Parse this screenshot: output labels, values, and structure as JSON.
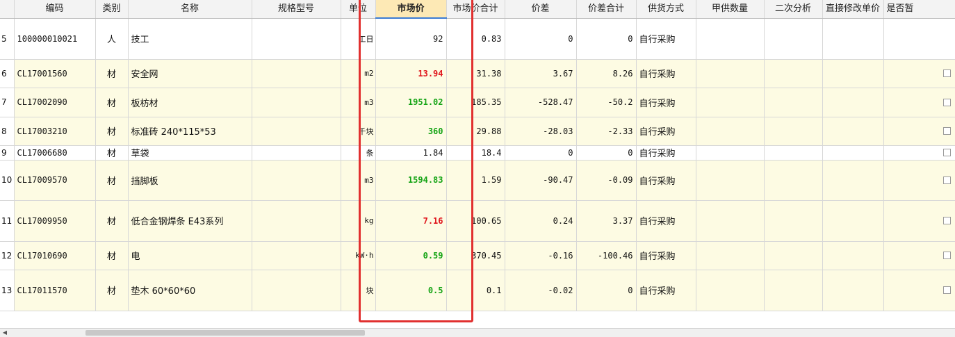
{
  "headers": [
    "",
    "编码",
    "类别",
    "名称",
    "规格型号",
    "单位",
    "市场价",
    "市场价合计",
    "价差",
    "价差合计",
    "供货方式",
    "甲供数量",
    "二次分析",
    "直接修改单价",
    "是否暂"
  ],
  "rows": [
    {
      "no": "5",
      "code": "100000010021",
      "type": "人",
      "name": "技工",
      "spec": "",
      "unit": "工日",
      "price": "92",
      "price_color": "black",
      "total": "0.83",
      "diff": "0",
      "diff_total": "0",
      "supply": "自行采购",
      "checkbox": false
    },
    {
      "no": "6",
      "code": "CL17001560",
      "type": "材",
      "name": "安全网",
      "spec": "",
      "unit": "m2",
      "price": "13.94",
      "price_color": "red",
      "total": "31.38",
      "diff": "3.67",
      "diff_total": "8.26",
      "supply": "自行采购",
      "checkbox": true
    },
    {
      "no": "7",
      "code": "CL17002090",
      "type": "材",
      "name": "板枋材",
      "spec": "",
      "unit": "m3",
      "price": "1951.02",
      "price_color": "green",
      "total": "185.35",
      "diff": "-528.47",
      "diff_total": "-50.2",
      "supply": "自行采购",
      "checkbox": true
    },
    {
      "no": "8",
      "code": "CL17003210",
      "type": "材",
      "name": "标准砖 240*115*53",
      "spec": "",
      "unit": "千块",
      "price": "360",
      "price_color": "green",
      "total": "29.88",
      "diff": "-28.03",
      "diff_total": "-2.33",
      "supply": "自行采购",
      "checkbox": true
    },
    {
      "no": "9",
      "code": "CL17006680",
      "type": "材",
      "name": "草袋",
      "spec": "",
      "unit": "条",
      "price": "1.84",
      "price_color": "black",
      "total": "18.4",
      "diff": "0",
      "diff_total": "0",
      "supply": "自行采购",
      "checkbox": true
    },
    {
      "no": "10",
      "code": "CL17009570",
      "type": "材",
      "name": "挡脚板",
      "spec": "",
      "unit": "m3",
      "price": "1594.83",
      "price_color": "green",
      "total": "1.59",
      "diff": "-90.47",
      "diff_total": "-0.09",
      "supply": "自行采购",
      "checkbox": true
    },
    {
      "no": "11",
      "code": "CL17009950",
      "type": "材",
      "name": "低合金钢焊条 E43系列",
      "spec": "",
      "unit": "kg",
      "price": "7.16",
      "price_color": "red",
      "total": "100.65",
      "diff": "0.24",
      "diff_total": "3.37",
      "supply": "自行采购",
      "checkbox": true
    },
    {
      "no": "12",
      "code": "CL17010690",
      "type": "材",
      "name": "电",
      "spec": "",
      "unit": "kW·h",
      "price": "0.59",
      "price_color": "green",
      "total": "370.45",
      "diff": "-0.16",
      "diff_total": "-100.46",
      "supply": "自行采购",
      "checkbox": true
    },
    {
      "no": "13",
      "code": "CL17011570",
      "type": "材",
      "name": "垫木 60*60*60",
      "spec": "",
      "unit": "块",
      "price": "0.5",
      "price_color": "green",
      "total": "0.1",
      "diff": "-0.02",
      "diff_total": "0",
      "supply": "自行采购",
      "checkbox": true
    }
  ],
  "colors": {
    "highlight": "#e1302f",
    "red_price": "#e0141b",
    "green_price": "#13a313",
    "row_yellow": "#fdfbe3"
  }
}
